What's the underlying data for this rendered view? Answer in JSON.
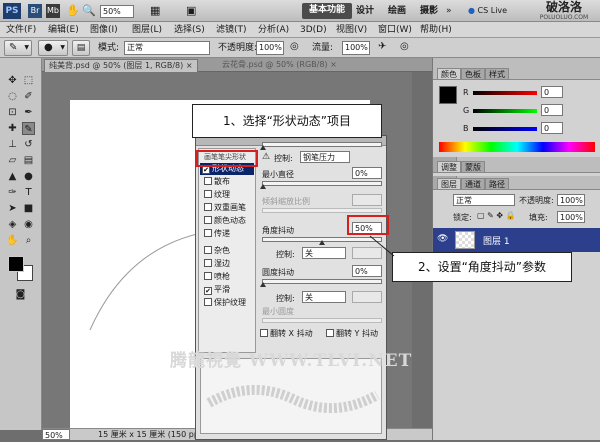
{
  "titlebar": {
    "app_badge": "PS",
    "zoom": "50%",
    "workspace_button": "基本功能",
    "workspaces": [
      "设计",
      "绘画",
      "摄影"
    ],
    "cs_live": "CS Live",
    "logo_text": "破洛洛",
    "logo_sub": "POLUOLUO.COM"
  },
  "menu": {
    "items": [
      "文件(F)",
      "编辑(E)",
      "图像(I)",
      "图层(L)",
      "选择(S)",
      "滤镜(T)",
      "分析(A)",
      "3D(D)",
      "视图(V)",
      "窗口(W)",
      "帮助(H)"
    ]
  },
  "options": {
    "mode_label": "模式:",
    "mode_value": "正常",
    "opacity_label": "不透明度:",
    "opacity_value": "100%",
    "flow_label": "流量:",
    "flow_value": "100%"
  },
  "tabs": [
    {
      "label": "纯美背.psd @ 50% (图层 1, RGB/8)",
      "active": true
    },
    {
      "label": "云花骨.psd @ 50% (RGB/8)",
      "active": false
    }
  ],
  "statusbar": {
    "zoom": "50%",
    "doc_size": "15 厘米 x 15 厘米 (150 ppi)"
  },
  "color_panel": {
    "tabs": [
      "颜色",
      "色板",
      "样式"
    ],
    "channels": [
      {
        "label": "R",
        "value": "0"
      },
      {
        "label": "G",
        "value": "0"
      },
      {
        "label": "B",
        "value": "0"
      }
    ]
  },
  "adjust_panel": {
    "tabs": [
      "调整",
      "蒙版"
    ]
  },
  "layers_panel": {
    "tabs": [
      "图层",
      "通道",
      "路径"
    ],
    "blend_mode": "正常",
    "opacity_label": "不透明度:",
    "opacity_value": "100%",
    "lock_label": "锁定:",
    "fill_label": "填充:",
    "fill_value": "100%",
    "layer_name": "图层 1"
  },
  "brush_panel": {
    "header_item": "画笔笔尖形状",
    "items": [
      {
        "label": "形状动态",
        "checked": true,
        "selected": true
      },
      {
        "label": "散布",
        "checked": false
      },
      {
        "label": "纹理",
        "checked": false
      },
      {
        "label": "双重画笔",
        "checked": false
      },
      {
        "label": "颜色动态",
        "checked": false
      },
      {
        "label": "传递",
        "checked": false
      },
      {
        "label": "杂色",
        "checked": false
      },
      {
        "label": "湿边",
        "checked": false
      },
      {
        "label": "喷枪",
        "checked": false
      },
      {
        "label": "平滑",
        "checked": true
      },
      {
        "label": "保护纹理",
        "checked": false
      }
    ],
    "control_label": "控制:",
    "size_control": "钢笔压力",
    "min_diameter_label": "最小直径",
    "min_diameter_value": "0%",
    "tilt_scale_label": "倾斜缩放比例",
    "angle_jitter_label": "角度抖动",
    "angle_jitter_value": "50%",
    "angle_control": "关",
    "roundness_jitter_label": "圆度抖动",
    "roundness_jitter_value": "0%",
    "roundness_control": "关",
    "min_roundness_label": "最小圆度",
    "flip_x": "翻转 X 抖动",
    "flip_y": "翻转 Y 抖动",
    "angle_jitter_level": 0.5
  },
  "callouts": {
    "step1": "1、选择“形状动态”项目",
    "step2": "2、设置“角度抖动”参数"
  },
  "watermark": "腾龍視覺 WWW.TLVI.NET",
  "colors": {
    "callout_border": "#d62020",
    "selected_layer": "#2b3f8c"
  }
}
